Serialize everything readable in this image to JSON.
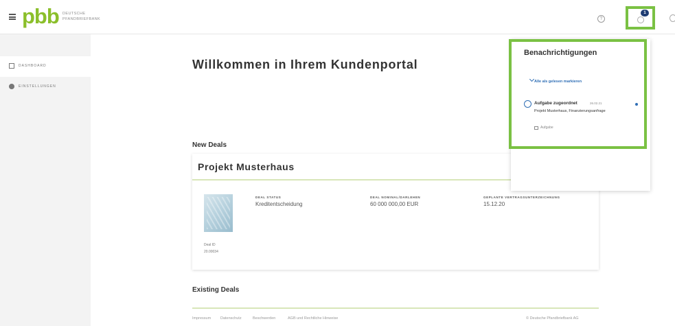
{
  "header": {
    "logo_text": "pbb",
    "logo_subtitle_line1": "DEUTSCHE",
    "logo_subtitle_line2": "PFANDBRIEFBANK",
    "help_glyph": "?",
    "notification_count": "1",
    "icons": [
      "menu-icon",
      "help-icon",
      "bell-icon",
      "user-icon"
    ],
    "highlight_color": "#7ac143",
    "brand_color": "#8bbf2b"
  },
  "sidebar": {
    "items": [
      {
        "label": "DASHBOARD",
        "icon": "dashboard-icon",
        "active": true
      },
      {
        "label": "EINSTELLUNGEN",
        "icon": "gear-icon",
        "active": false
      }
    ]
  },
  "main": {
    "welcome": "Willkommen in Ihrem Kundenportal",
    "new_deals_title": "New Deals",
    "deal": {
      "name": "Projekt Musterhaus",
      "status_label": "DEAL STATUS",
      "status_value": "Kreditentscheidung",
      "loan_label": "DEAL NOMINAL/DARLEHEN",
      "loan_value": "60 000 000,00 EUR",
      "signing_label": "GEPLANTE VERTRAGSUNTERZEICHNUNG",
      "signing_value": "15.12.20",
      "id_label": "Deal ID",
      "id_value": "20.00034"
    },
    "existing_deals_title": "Existing Deals"
  },
  "footer": {
    "links": [
      "Impressum",
      "Datenschutz",
      "Beschwerden",
      "AGB und Rechtliche Hinweise"
    ],
    "copyright": "© Deutsche Pfandbriefbank AG"
  },
  "notifications": {
    "title": "Benachrichtigungen",
    "mark_all_read": "Alle als gelesen markieren",
    "items": [
      {
        "title": "Aufgabe zugeordnet",
        "time": "26.02.21",
        "description": "Projekt Musterhaus, Finanzierungsanfrage",
        "tag": "Aufgabe",
        "unread": true
      }
    ]
  }
}
